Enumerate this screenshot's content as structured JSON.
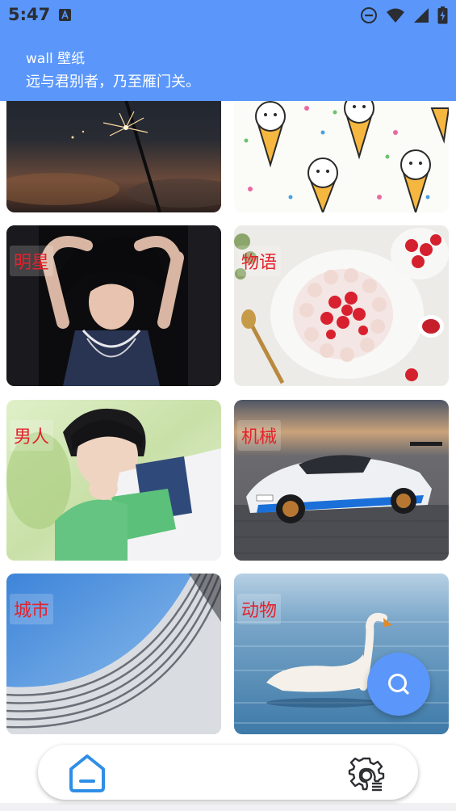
{
  "status_bar": {
    "time": "5:47",
    "icons": [
      "notification-a-icon",
      "do-not-disturb-icon",
      "wifi-icon",
      "signal-icon",
      "battery-charging-icon"
    ]
  },
  "header": {
    "title": "wall 壁纸",
    "subtitle": "远与君别者，乃至雁门关。"
  },
  "wallpapers": [
    {
      "label": "",
      "image": "sparkler-at-dusk"
    },
    {
      "label": "",
      "image": "ice-cream-bear-pattern"
    },
    {
      "label": "明星",
      "image": "woman-in-denim"
    },
    {
      "label": "物语",
      "image": "strawberry-cake"
    },
    {
      "label": "男人",
      "image": "young-man-in-green-jacket"
    },
    {
      "label": "机械",
      "image": "white-sports-car"
    },
    {
      "label": "城市",
      "image": "curved-building-facade"
    },
    {
      "label": "动物",
      "image": "swan-on-water"
    }
  ],
  "fab": {
    "icon": "search-icon"
  },
  "bottom_nav": {
    "items": [
      {
        "icon": "home-icon",
        "active": true
      },
      {
        "icon": "settings-icon",
        "active": false
      }
    ]
  },
  "colors": {
    "accent": "#5b97fb",
    "label_text": "#e5222b",
    "status_icons": "#2a2d33"
  }
}
